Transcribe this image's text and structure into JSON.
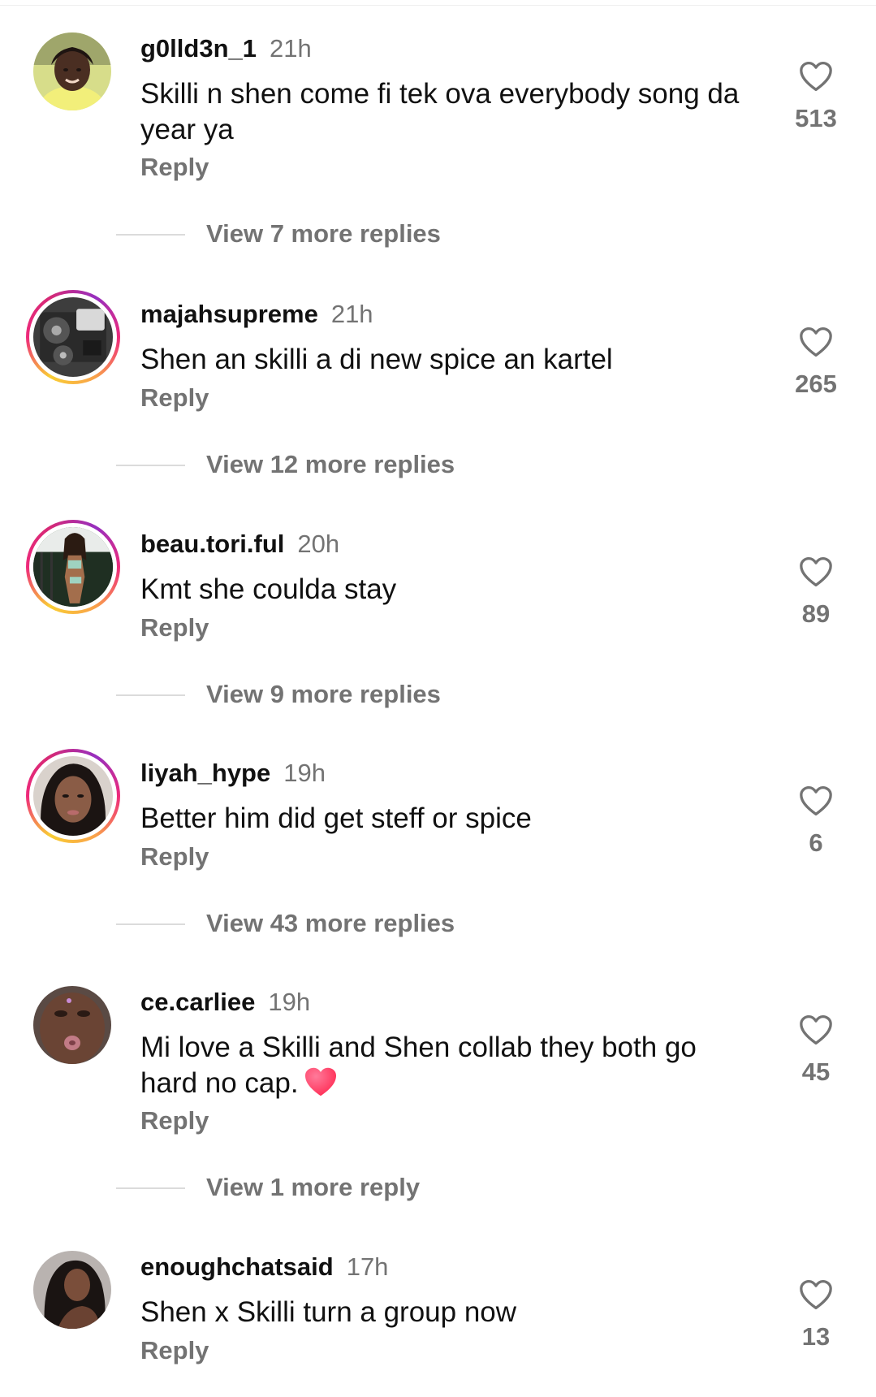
{
  "comments": [
    {
      "username": "g0lld3n_1",
      "time": "21h",
      "text": "Skilli n shen come fi tek ova everybody song da year ya",
      "reply_label": "Reply",
      "likes": "513",
      "view_replies": "View 7 more replies",
      "has_story": false,
      "avatar_icon": "profile-photo"
    },
    {
      "username": "majahsupreme",
      "time": "21h",
      "text": "Shen an skilli a di new spice an kartel",
      "reply_label": "Reply",
      "likes": "265",
      "view_replies": "View 12 more replies",
      "has_story": true,
      "avatar_icon": "dj-controller-photo"
    },
    {
      "username": "beau.tori.ful",
      "time": "20h",
      "text": "Kmt she coulda stay",
      "reply_label": "Reply",
      "likes": "89",
      "view_replies": "View 9 more replies",
      "has_story": true,
      "avatar_icon": "profile-photo"
    },
    {
      "username": "liyah_hype",
      "time": "19h",
      "text": "Better him did get steff or spice",
      "reply_label": "Reply",
      "likes": "6",
      "view_replies": "View 43 more replies",
      "has_story": true,
      "avatar_icon": "profile-photo"
    },
    {
      "username": "ce.carliee",
      "time": "19h",
      "text": "Mi love a Skilli and Shen collab they both go hard no cap.",
      "emoji": "red-heart-emoji",
      "reply_label": "Reply",
      "likes": "45",
      "view_replies": "View 1 more reply",
      "has_story": false,
      "avatar_icon": "profile-photo"
    },
    {
      "username": "enoughchatsaid",
      "time": "17h",
      "text": "Shen x Skilli turn a group now",
      "reply_label": "Reply",
      "likes": "13",
      "has_story": false,
      "avatar_icon": "profile-photo"
    }
  ],
  "colors": {
    "primary_text": "#111111",
    "secondary_text": "#737373",
    "divider": "#dbdbdb",
    "emoji_heart": "#ff2d55"
  }
}
